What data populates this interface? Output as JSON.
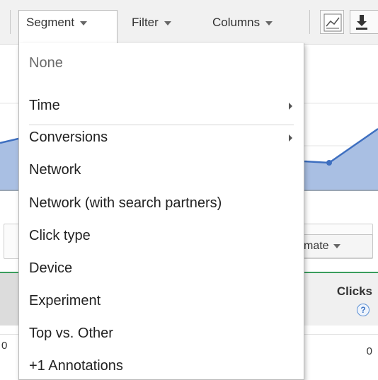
{
  "toolbar": {
    "segment_label": "Segment",
    "filter_label": "Filter",
    "columns_label": "Columns",
    "icons": [
      "line-chart-icon",
      "download-icon"
    ]
  },
  "segment_menu": {
    "none_label": "None",
    "items": [
      {
        "label": "Time",
        "has_submenu": true
      },
      {
        "label": "Conversions",
        "has_submenu": true
      },
      {
        "label": "Network",
        "has_submenu": false
      },
      {
        "label": "Network (with search partners)",
        "has_submenu": false
      },
      {
        "label": "Click type",
        "has_submenu": false
      },
      {
        "label": "Device",
        "has_submenu": false
      },
      {
        "label": "Experiment",
        "has_submenu": false
      },
      {
        "label": "Top vs. Other",
        "has_submenu": false
      },
      {
        "label": "+1 Annotations",
        "has_submenu": false
      }
    ]
  },
  "background": {
    "estimate_button_label": "mate",
    "clicks_header": "Clicks",
    "help_label": "?",
    "row_left_value": "0",
    "row_right_value": "0"
  },
  "colors": {
    "chart_fill": "#a9bfe3",
    "chart_line": "#3e6fc0",
    "accent_green": "#3a9d5d"
  }
}
